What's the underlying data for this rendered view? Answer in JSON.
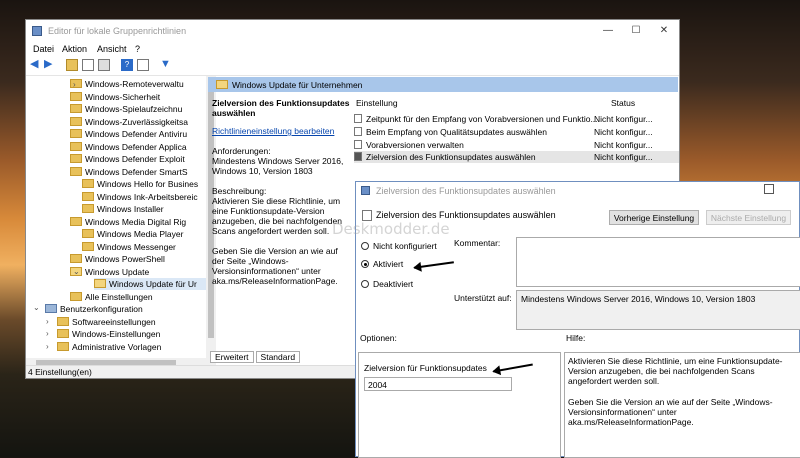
{
  "main_window": {
    "title": "Editor für lokale Gruppenrichtlinien",
    "menu": [
      "Datei",
      "Aktion",
      "Ansicht",
      "?"
    ],
    "tree": [
      {
        "label": "Windows-Remoteverwaltu",
        "indent": 3
      },
      {
        "label": "Windows-Sicherheit",
        "indent": 3
      },
      {
        "label": "Windows-Spielaufzeichnu",
        "indent": 3
      },
      {
        "label": "Windows-Zuverlässigkeitsa",
        "indent": 3
      },
      {
        "label": "Windows Defender Antiviru",
        "indent": 3
      },
      {
        "label": "Windows Defender Applica",
        "indent": 3
      },
      {
        "label": "Windows Defender Exploit",
        "indent": 3
      },
      {
        "label": "Windows Defender SmartS",
        "indent": 3
      },
      {
        "label": "Windows Hello for Busines",
        "indent": 3
      },
      {
        "label": "Windows Ink-Arbeitsbereic",
        "indent": 3
      },
      {
        "label": "Windows Installer",
        "indent": 3
      },
      {
        "label": "Windows Media Digital Rig",
        "indent": 3
      },
      {
        "label": "Windows Media Player",
        "indent": 3
      },
      {
        "label": "Windows Messenger",
        "indent": 3
      },
      {
        "label": "Windows PowerShell",
        "indent": 3
      },
      {
        "label": "Windows Update",
        "indent": 3
      },
      {
        "label": "Windows Update für Ur",
        "indent": 4
      },
      {
        "label": "Alle Einstellungen",
        "indent": 2
      },
      {
        "label": "Benutzerkonfiguration",
        "indent": 0
      },
      {
        "label": "Softwareeinstellungen",
        "indent": 1
      },
      {
        "label": "Windows-Einstellungen",
        "indent": 1
      },
      {
        "label": "Administrative Vorlagen",
        "indent": 1
      }
    ],
    "pane_header": "Windows Update für Unternehmen",
    "detail": {
      "heading": "Zielversion des Funktionsupdates auswählen",
      "link": "Richtlinieneinstellung bearbeiten",
      "requirements_label": "Anforderungen:",
      "requirements": "Mindestens Windows Server 2016, Windows 10, Version 1803",
      "description_label": "Beschreibung:",
      "description": "Aktivieren Sie diese Richtlinie, um eine Funktionsupdate-Version anzugeben, die bei nachfolgenden Scans angefordert werden soll.",
      "description2": "Geben Sie die Version an wie auf der Seite „Windows-Versionsinformationen“ unter aka.ms/ReleaseInformationPage."
    },
    "columns": {
      "setting": "Einstellung",
      "status": "Status"
    },
    "rows": [
      {
        "name": "Zeitpunkt für den Empfang von Vorabversionen und Funktio...",
        "status": "Nicht konfigur..."
      },
      {
        "name": "Beim Empfang von Qualitätsupdates auswählen",
        "status": "Nicht konfigur..."
      },
      {
        "name": "Vorabversionen verwalten",
        "status": "Nicht konfigur..."
      },
      {
        "name": "Zielversion des Funktionsupdates auswählen",
        "status": "Nicht konfigur..."
      }
    ],
    "tabs": [
      "Erweitert",
      "Standard"
    ],
    "status_bar": "4 Einstellung(en)"
  },
  "dialog": {
    "title": "Zielversion des Funktionsupdates auswählen",
    "header_label": "Zielversion des Funktionsupdates auswählen",
    "prev_button": "Vorherige Einstellung",
    "next_button": "Nächste Einstellung",
    "radios": [
      "Nicht konfiguriert",
      "Aktiviert",
      "Deaktiviert"
    ],
    "selected_radio": "Aktiviert",
    "comment_label": "Kommentar:",
    "supported_label": "Unterstützt auf:",
    "supported_value": "Mindestens Windows Server 2016, Windows 10, Version 1803",
    "options_label": "Optionen:",
    "help_label": "Hilfe:",
    "option_field_label": "Zielversion für Funktionsupdates",
    "option_field_value": "2004",
    "help_text1": "Aktivieren Sie diese Richtlinie, um eine Funktionsupdate-Version anzugeben, die bei nachfolgenden Scans angefordert werden soll.",
    "help_text2": "Geben Sie die Version an wie auf der Seite „Windows-Versionsinformationen“ unter aka.ms/ReleaseInformationPage."
  },
  "watermark": "Deskmodder.de"
}
